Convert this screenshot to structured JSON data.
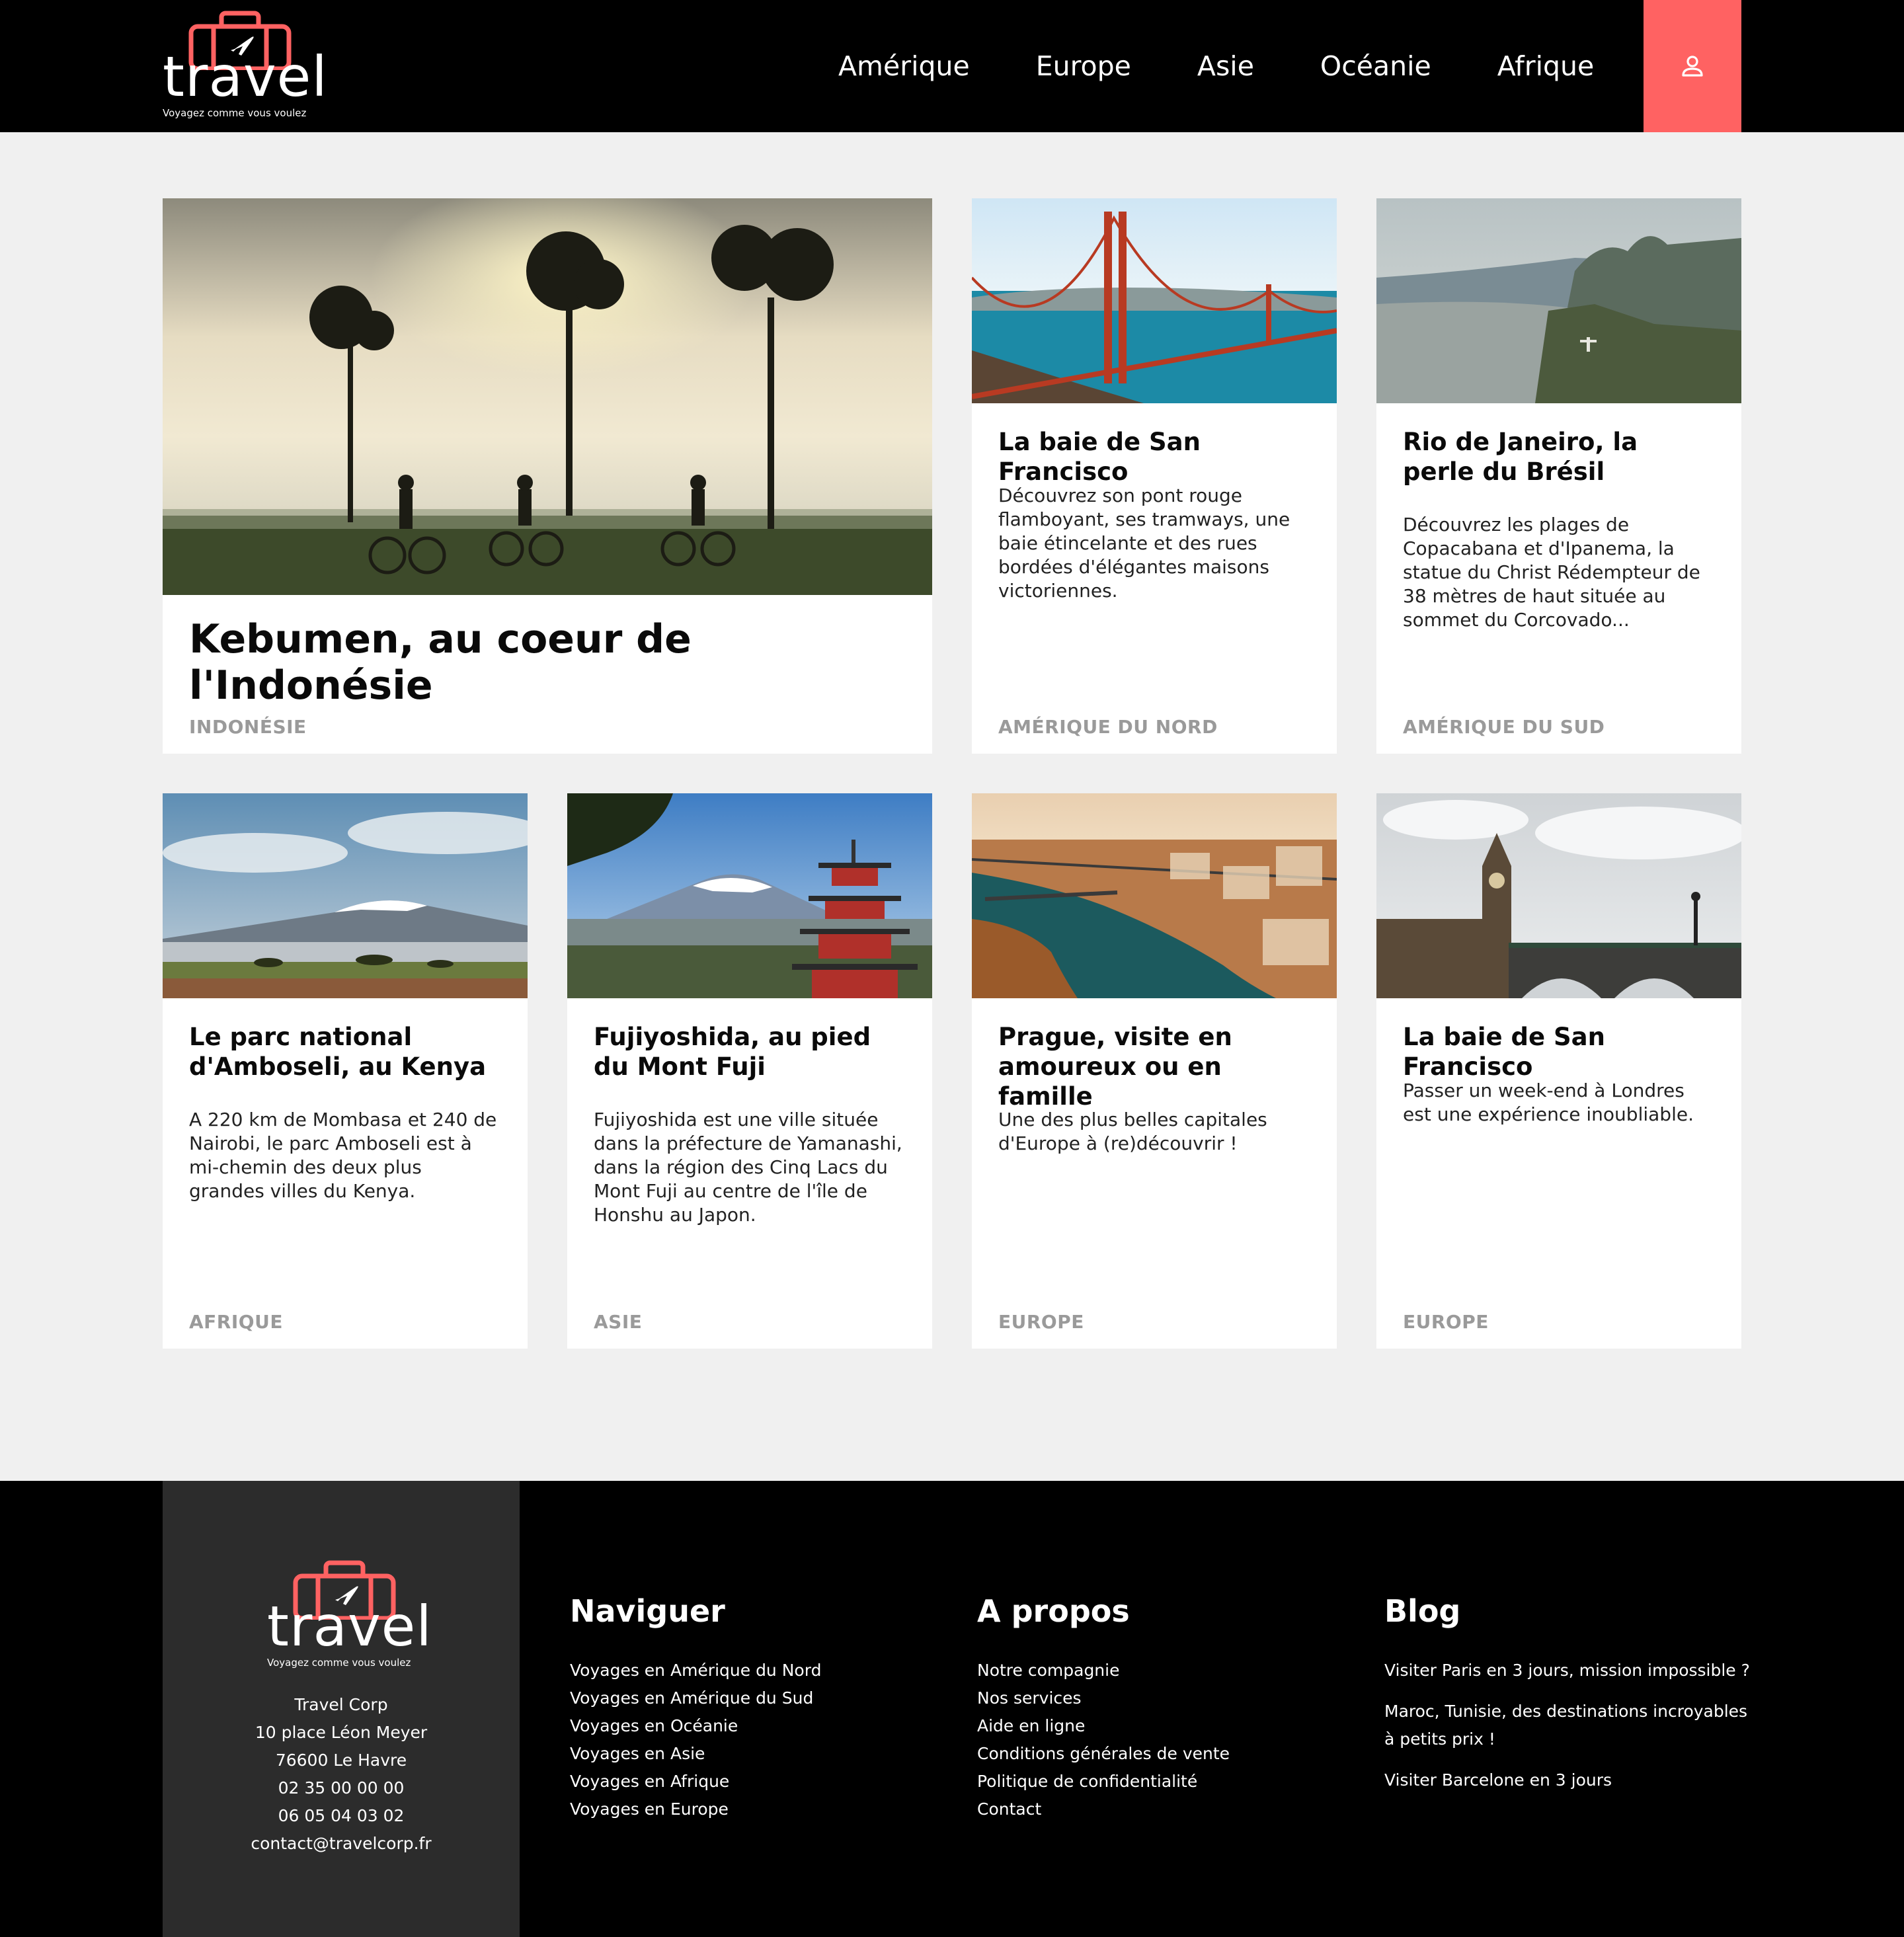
{
  "header": {
    "logo": {
      "word": "travel",
      "tagline": "Voyagez comme vous voulez"
    },
    "nav": [
      "Amérique",
      "Europe",
      "Asie",
      "Océanie",
      "Afrique"
    ]
  },
  "colors": {
    "accent": "#ff6262",
    "background": "#f0f0f0",
    "header": "#000000",
    "footer_left": "#2c2c2c",
    "category_text": "#9a9a9a"
  },
  "cards": [
    {
      "title": "Kebumen, au coeur de l'Indonésie",
      "description": "",
      "category": "Indonésie",
      "image": "cyclists-at-sunrise-indonesia"
    },
    {
      "title": "La baie de San Francisco",
      "description": "Découvrez son pont rouge flamboyant, ses tramways, une baie étincelante et des rues bordées d'élégantes maisons victoriennes.",
      "category": "Amérique du Nord",
      "image": "golden-gate-bridge"
    },
    {
      "title": "Rio de Janeiro, la perle du Brésil",
      "description": "Découvrez les plages de Copacabana et d'Ipanema, la statue du Christ Rédempteur de 38 mètres de haut située au sommet du Corcovado...",
      "category": "Amérique du Sud",
      "image": "rio-de-janeiro-aerial"
    },
    {
      "title": "Le parc national d'Amboseli, au Kenya",
      "description": "A 220 km de Mombasa et 240 de Nairobi, le parc Amboseli est à mi-chemin des deux plus grandes villes du Kenya.",
      "category": "Afrique",
      "image": "kilimanjaro-savanna"
    },
    {
      "title": "Fujiyoshida, au pied du Mont Fuji",
      "description": "Fujiyoshida est une ville située dans la préfecture de Yamanashi, dans la région des Cinq Lacs du Mont Fuji au centre de l'île de Honshu au Japon.",
      "category": "Asie",
      "image": "mount-fuji-pagoda"
    },
    {
      "title": "Prague, visite en amoureux ou en famille",
      "description": "Une des plus belles capitales d'Europe à (re)découvrir !",
      "category": "Europe",
      "image": "prague-river-aerial"
    },
    {
      "title": "La baie de San Francisco",
      "description": "Passer un week-end à Londres est une expérience inoubliable.",
      "category": "Europe",
      "image": "big-ben-westminster"
    }
  ],
  "footer": {
    "logo": {
      "word": "travel",
      "tagline": "Voyagez comme vous voulez"
    },
    "address": [
      "Travel Corp",
      "10 place Léon Meyer",
      "76600 Le Havre",
      "02 35 00 00 00",
      "06 05 04 03 02",
      "contact@travelcorp.fr"
    ],
    "columns": [
      {
        "heading": "Naviguer",
        "links": [
          "Voyages en Amérique du Nord",
          "Voyages en Amérique du Sud",
          "Voyages en Océanie",
          "Voyages en Asie",
          "Voyages en Afrique",
          "Voyages en Europe"
        ]
      },
      {
        "heading": "A propos",
        "links": [
          "Notre compagnie",
          "Nos services",
          "Aide en ligne",
          "Conditions générales de vente",
          "Politique de confidentialité",
          "Contact"
        ]
      },
      {
        "heading": "Blog",
        "links": [
          "Visiter Paris en 3 jours, mission impossible ?",
          "Maroc, Tunisie, des destinations incroyables à petits prix !",
          "Visiter Barcelone en 3 jours"
        ]
      }
    ]
  }
}
